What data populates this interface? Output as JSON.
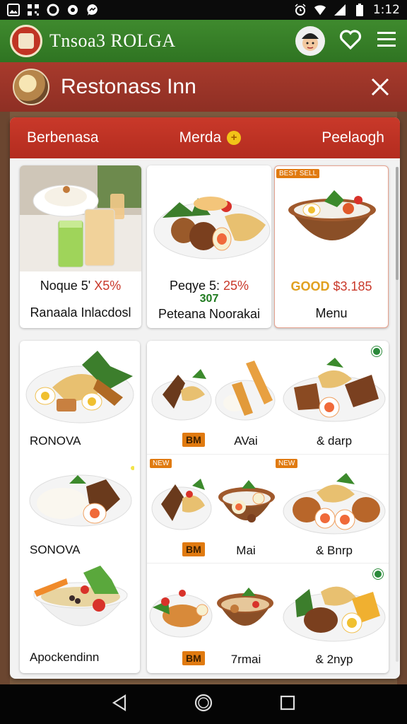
{
  "status_bar": {
    "time": "1:12",
    "left_icons": [
      "image-icon",
      "qr-icon",
      "circle-icon",
      "refresh-icon",
      "messenger-icon"
    ],
    "right_icons": [
      "alarm-icon",
      "wifi-icon",
      "signal-icon",
      "battery-icon"
    ]
  },
  "app_bar": {
    "title": "Tnsoa3 ROLGA",
    "icons": [
      "avatar-icon",
      "heart-icon",
      "menu-icon"
    ]
  },
  "restaurant_header": {
    "title": "Restonass Inn",
    "close_icon": "close-icon"
  },
  "tabs": [
    {
      "label": "Berbenasa"
    },
    {
      "label": "Merda",
      "indicator": "+"
    },
    {
      "label": "Peelaogh"
    }
  ],
  "featured": [
    {
      "line1": "Noque",
      "num": "5'",
      "price": "X5%",
      "sub": "",
      "name": "Ranaala Inlacdosl"
    },
    {
      "line1": "Peqye",
      "num": "5:",
      "price": "25%",
      "sub": "307",
      "name": "Peteana Noorakai"
    },
    {
      "line1": "GOOD",
      "num": "",
      "price": "$3.185",
      "sub": "",
      "name": "Menu",
      "tag": "BEST SELL"
    }
  ],
  "left_items": [
    {
      "label": "RONOVA"
    },
    {
      "label": "SONOVA"
    },
    {
      "label": "Apockendinn"
    }
  ],
  "grid_rows": [
    {
      "badge": "BM",
      "middle": "AVai",
      "right": "& darp"
    },
    {
      "badge": "BM",
      "middle": "Mai",
      "right": "& Bnrp",
      "tag": "NEW"
    },
    {
      "badge": "BM",
      "middle": "7rmai",
      "right": "& 2nyp"
    }
  ],
  "colors": {
    "app_bar": "#2f7422",
    "header": "#8e2f24",
    "tab_bar": "#c9392a",
    "accent_orange": "#e07a10",
    "price_red": "#c9392a",
    "price_green": "#1f7a1f"
  }
}
